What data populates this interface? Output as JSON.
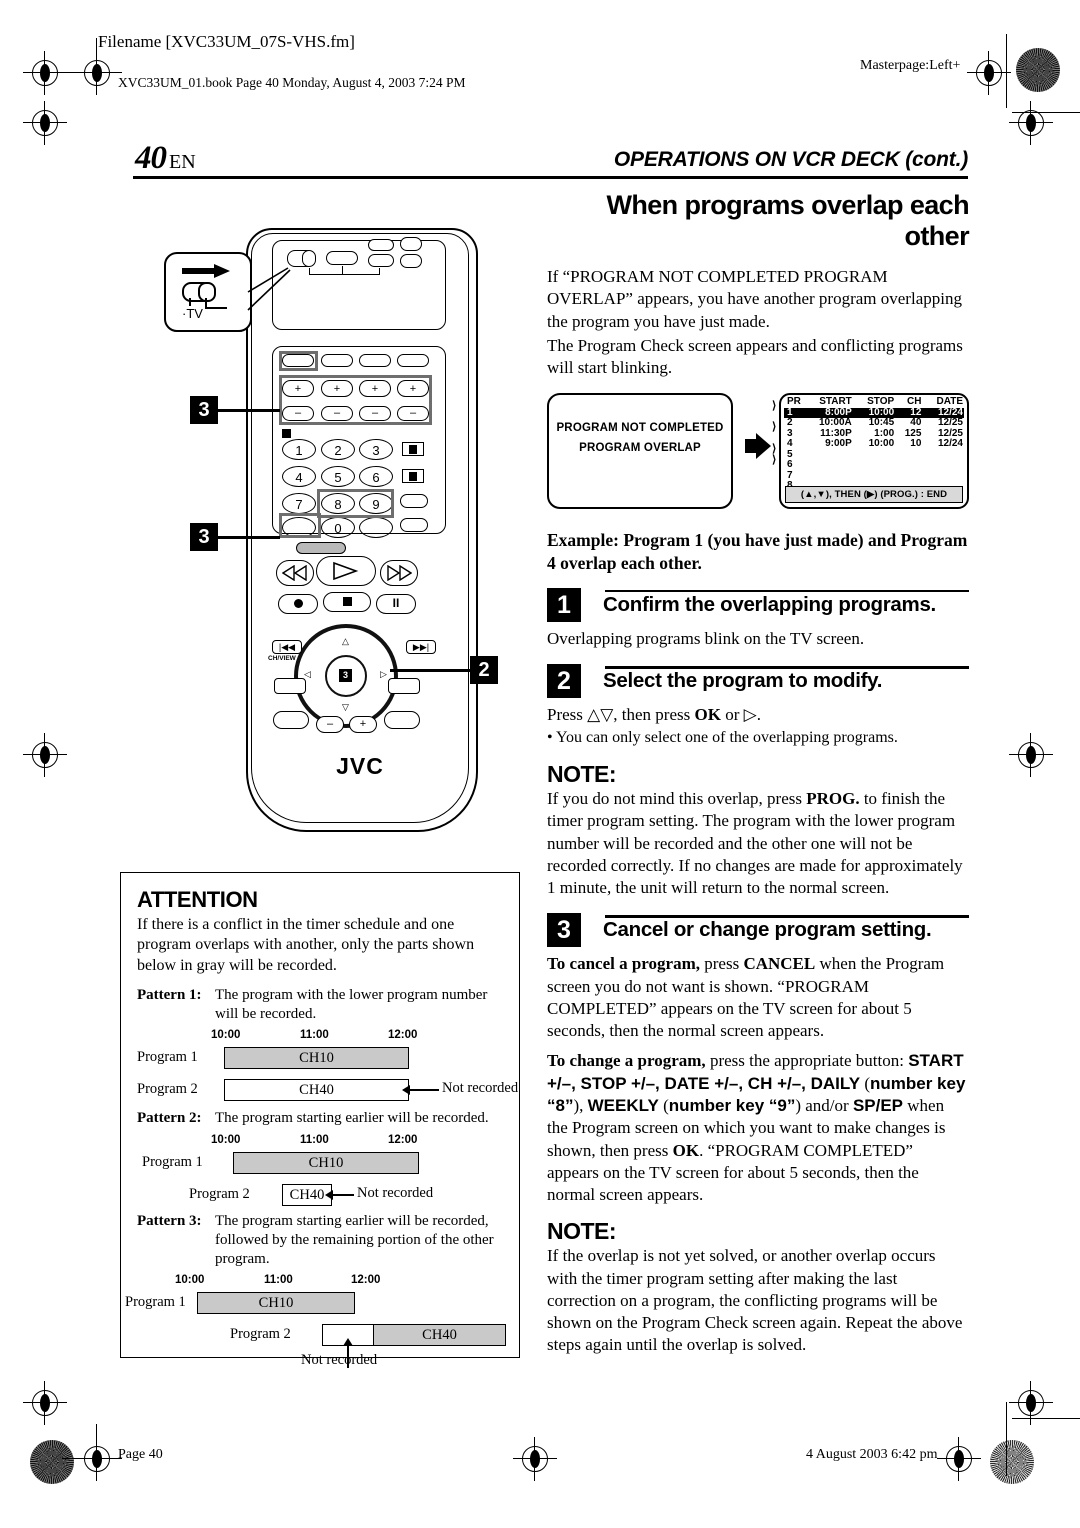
{
  "slugs": {
    "filename": "Filename [XVC33UM_07S-VHS.fm]",
    "book": "XVC33UM_01.book  Page 40  Monday, August 4, 2003  7:24 PM",
    "masterpage": "Masterpage:Left+",
    "page_footer": "Page 40",
    "date_footer": "4 August 2003 6:42 pm"
  },
  "header": {
    "page_number": "40",
    "page_lang": "EN",
    "running_head": "OPERATIONS ON VCR DECK (cont.)"
  },
  "section": {
    "title": "When programs overlap each other",
    "intro_1": "If “PROGRAM NOT COMPLETED PROGRAM OVERLAP” appears, you have another program overlapping the program you have just made.",
    "intro_2": "The Program Check screen appears and conflicting programs will start blinking."
  },
  "osd": {
    "message_line1": "PROGRAM NOT COMPLETED",
    "message_line2": "PROGRAM OVERLAP",
    "arrow": "right-arrow-icon",
    "program_check": {
      "columns": [
        "PR",
        "START",
        "STOP",
        "CH",
        "DATE"
      ],
      "rows": [
        {
          "pr": "1",
          "start": "8:00P",
          "stop": "10:00",
          "ch": "12",
          "date": "12/24",
          "highlighted": true
        },
        {
          "pr": "2",
          "start": "10:00A",
          "stop": "10:45",
          "ch": "40",
          "date": "12/25",
          "highlighted": false
        },
        {
          "pr": "3",
          "start": "11:30P",
          "stop": "1:00",
          "ch": "125",
          "date": "12/25",
          "highlighted": false
        },
        {
          "pr": "4",
          "start": "9:00P",
          "stop": "10:00",
          "ch": "10",
          "date": "12/24",
          "highlighted": false
        },
        {
          "pr": "5",
          "start": "",
          "stop": "",
          "ch": "",
          "date": "",
          "highlighted": false
        },
        {
          "pr": "6",
          "start": "",
          "stop": "",
          "ch": "",
          "date": "",
          "highlighted": false
        },
        {
          "pr": "7",
          "start": "",
          "stop": "",
          "ch": "",
          "date": "",
          "highlighted": false
        },
        {
          "pr": "8",
          "start": "",
          "stop": "",
          "ch": "",
          "date": "",
          "highlighted": false
        }
      ],
      "footer": "(▲,▼), THEN (▶) (PROG.) : END"
    }
  },
  "example_caption": "Example: Program 1 (you have just made) and Program 4 overlap each other.",
  "steps": [
    {
      "number": "1",
      "title": "Confirm the overlapping programs.",
      "body": "Overlapping programs blink on the TV screen."
    },
    {
      "number": "2",
      "title": "Select the program to modify.",
      "body": "Press △▽, then press OK or ▷.",
      "bullet": "• You can only select one of the overlapping programs."
    },
    {
      "number": "3",
      "title": "Cancel or change program setting.",
      "cancel_label": "To cancel a program,",
      "cancel_body": " press CANCEL when the Program screen you do not want is shown. “PROGRAM COMPLETED” appears on the TV screen for about 5 seconds, then the normal screen appears.",
      "change_label": "To change a program,",
      "change_body_1": " press the appropriate button: ",
      "change_buttons": "START +/–, STOP +/–, DATE +/–, CH +/–, DAILY (number key “8”), WEEKLY (number key “9”)",
      "change_body_2": " and/or ",
      "change_buttons_2": "SP/EP",
      "change_body_3": " when the Program screen on which you want to make changes is shown, then press OK. “PROGRAM COMPLETED” appears on the TV screen for about 5 seconds, then the normal screen appears."
    }
  ],
  "notes": [
    {
      "heading": "NOTE:",
      "body": "If you do not mind this overlap, press PROG. to finish the timer program setting. The program with the lower program number will be recorded and the other one will not be recorded correctly. If no changes are made for approximately 1 minute, the unit will return to the normal screen."
    },
    {
      "heading": "NOTE:",
      "body": "If the overlap is not yet solved, or another overlap occurs with the timer program setting after making the last correction on a program, the conflicting programs will be shown on the Program Check screen again. Repeat the above steps again until the overlap is solved."
    }
  ],
  "remote": {
    "brand": "JVC",
    "tv_switch_label": "TV",
    "callouts": [
      "3",
      "3",
      "2"
    ],
    "number_keys": [
      "1",
      "2",
      "3",
      "4",
      "5",
      "6",
      "7",
      "8",
      "9",
      "0"
    ],
    "preview_label": "CH/VIEW"
  },
  "attention": {
    "heading": "ATTENTION",
    "body": "If there is a conflict in the timer schedule and one program overlaps with another, only the parts shown below in gray will be recorded.",
    "patterns": [
      {
        "label": "Pattern 1:",
        "text": "The program with the lower program number will be recorded.",
        "times": [
          "10:00",
          "11:00",
          "12:00"
        ],
        "rows": [
          {
            "name": "Program 1",
            "channel": "CH10",
            "recorded": true
          },
          {
            "name": "Program 2",
            "channel": "CH40",
            "recorded": false
          }
        ],
        "annotation": "Not recorded"
      },
      {
        "label": "Pattern 2:",
        "text": "The program starting earlier will be recorded.",
        "times": [
          "10:00",
          "11:00",
          "12:00"
        ],
        "rows": [
          {
            "name": "Program 1",
            "channel": "CH10",
            "recorded": true
          },
          {
            "name": "Program 2",
            "channel": "CH40",
            "recorded": false
          }
        ],
        "annotation": "Not recorded"
      },
      {
        "label": "Pattern 3:",
        "text": "The program starting earlier will be recorded, followed by the remaining portion of the other program.",
        "times": [
          "10:00",
          "11:00",
          "12:00"
        ],
        "rows": [
          {
            "name": "Program 1",
            "channel": "CH10",
            "recorded": true
          },
          {
            "name": "Program 2",
            "channel": "CH40",
            "recorded": true
          }
        ],
        "annotation": "Not recorded"
      }
    ]
  }
}
